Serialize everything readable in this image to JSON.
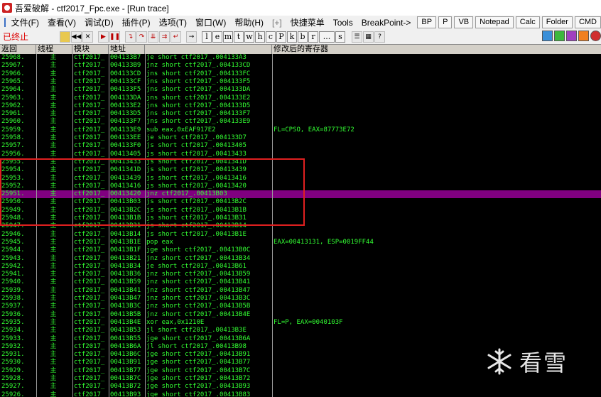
{
  "window": {
    "title": "吾爱破解 - ctf2017_Fpc.exe - [Run trace]"
  },
  "menu": {
    "items": [
      "文件(F)",
      "查看(V)",
      "调试(D)",
      "插件(P)",
      "选项(T)",
      "窗口(W)",
      "帮助(H)",
      "[+]",
      "快捷菜单",
      "Tools",
      "BreakPoint->"
    ],
    "buttons": [
      "BP",
      "P",
      "VB",
      "Notepad",
      "Calc",
      "Folder",
      "CMD"
    ]
  },
  "toolbar": {
    "status": "已终止",
    "letters": [
      "l",
      "e",
      "m",
      "t",
      "w",
      "h",
      "c",
      "P",
      "k",
      "b",
      "r",
      "...",
      "s"
    ]
  },
  "table": {
    "headers": [
      "返回",
      "线程",
      "模块",
      "地址",
      "",
      "修改后的寄存器"
    ],
    "thread_marker": "主",
    "rows": [
      [
        "25968.",
        "ctf2017_",
        "004133B7",
        "je short ctf2017_.004133A3",
        ""
      ],
      [
        "25967.",
        "ctf2017_",
        "004133B9",
        "jnz short ctf2017_.004133CD",
        ""
      ],
      [
        "25966.",
        "ctf2017_",
        "004133CD",
        "jns short ctf2017_.004133FC",
        ""
      ],
      [
        "25965.",
        "ctf2017_",
        "004133CF",
        "jns short ctf2017_.004133F5",
        ""
      ],
      [
        "25964.",
        "ctf2017_",
        "004133F5",
        "jns short ctf2017_.004133DA",
        ""
      ],
      [
        "25963.",
        "ctf2017_",
        "004133DA",
        "jns short ctf2017_.004133E2",
        ""
      ],
      [
        "25962.",
        "ctf2017_",
        "004133E2",
        "jns short ctf2017_.004133D5",
        ""
      ],
      [
        "25961.",
        "ctf2017_",
        "004133D5",
        "jns short ctf2017_.004133F7",
        ""
      ],
      [
        "25960.",
        "ctf2017_",
        "004133F7",
        "jns short ctf2017_.004133E9",
        ""
      ],
      [
        "25959.",
        "ctf2017_",
        "004133E9",
        "sub eax,0xEAF917E2",
        "FL=CPSO, EAX=87773E72"
      ],
      [
        "25958.",
        "ctf2017_",
        "004133EE",
        "je short ctf2017_.004133D7",
        ""
      ],
      [
        "25957.",
        "ctf2017_",
        "004133F0",
        "js short ctf2017_.00413405",
        ""
      ],
      [
        "25956.",
        "ctf2017_",
        "00413405",
        "js short ctf2017_.00413433",
        ""
      ],
      [
        "25955.",
        "ctf2017_",
        "00413433",
        "js short ctf2017_.0041341D",
        ""
      ],
      [
        "25954.",
        "ctf2017_",
        "0041341D",
        "js short ctf2017_.00413439",
        ""
      ],
      [
        "25953.",
        "ctf2017_",
        "00413439",
        "js short ctf2017_.00413416",
        ""
      ],
      [
        "25952.",
        "ctf2017_",
        "00413416",
        "js short ctf2017_.00413420",
        ""
      ],
      [
        "25951.",
        "ctf2017_",
        "00413420",
        "jnz ctf2017_.00413B03",
        ""
      ],
      [
        "25950.",
        "ctf2017_",
        "00413B03",
        "js short ctf2017_.00413B2C",
        ""
      ],
      [
        "25949.",
        "ctf2017_",
        "00413B2C",
        "js short ctf2017_.00413B1B",
        ""
      ],
      [
        "25948.",
        "ctf2017_",
        "00413B1B",
        "js short ctf2017_.00413B31",
        ""
      ],
      [
        "25947.",
        "ctf2017_",
        "00413B31",
        "js short ctf2017_.00413B14",
        ""
      ],
      [
        "25946.",
        "ctf2017_",
        "00413B14",
        "js short ctf2017_.00413B1E",
        ""
      ],
      [
        "25945.",
        "ctf2017_",
        "00413B1E",
        "pop eax",
        "EAX=00413131, ESP=0019FF44"
      ],
      [
        "25944.",
        "ctf2017_",
        "00413B1F",
        "jge short ctf2017_.00413B0C",
        ""
      ],
      [
        "25943.",
        "ctf2017_",
        "00413B21",
        "jnz short ctf2017_.00413B34",
        ""
      ],
      [
        "25942.",
        "ctf2017_",
        "00413B34",
        "je short ctf2017_.00413B61",
        ""
      ],
      [
        "25941.",
        "ctf2017_",
        "00413B36",
        "jnz short ctf2017_.00413B59",
        ""
      ],
      [
        "25940.",
        "ctf2017_",
        "00413B59",
        "jnz short ctf2017_.00413B41",
        ""
      ],
      [
        "25939.",
        "ctf2017_",
        "00413B41",
        "jnz short ctf2017_.00413B47",
        ""
      ],
      [
        "25938.",
        "ctf2017_",
        "00413B47",
        "jnz short ctf2017_.00413B3C",
        ""
      ],
      [
        "25937.",
        "ctf2017_",
        "00413B3C",
        "jnz short ctf2017_.00413B5B",
        ""
      ],
      [
        "25936.",
        "ctf2017_",
        "00413B5B",
        "jnz short ctf2017_.00413B4E",
        ""
      ],
      [
        "25935.",
        "ctf2017_",
        "00413B4E",
        "xor eax,0x1210E",
        "FL=P, EAX=0040103F"
      ],
      [
        "25934.",
        "ctf2017_",
        "00413B53",
        "jl short ctf2017_.00413B3E",
        ""
      ],
      [
        "25933.",
        "ctf2017_",
        "00413B55",
        "jge short ctf2017_.00413B6A",
        ""
      ],
      [
        "25932.",
        "ctf2017_",
        "00413B6A",
        "jl short ctf2017_.00413B98",
        ""
      ],
      [
        "25931.",
        "ctf2017_",
        "00413B6C",
        "jge short ctf2017_.00413B91",
        ""
      ],
      [
        "25930.",
        "ctf2017_",
        "00413B91",
        "jge short ctf2017_.00413B77",
        ""
      ],
      [
        "25929.",
        "ctf2017_",
        "00413B77",
        "jge short ctf2017_.00413B7C",
        ""
      ],
      [
        "25928.",
        "ctf2017_",
        "00413B7C",
        "jge short ctf2017_.00413B72",
        ""
      ],
      [
        "25927.",
        "ctf2017_",
        "00413B72",
        "jge short ctf2017_.00413B93",
        ""
      ],
      [
        "25926.",
        "ctf2017_",
        "00413B93",
        "jge short ctf2017_.00413B83",
        ""
      ]
    ],
    "selected_index": 17
  },
  "watermark": {
    "text": "看雪"
  },
  "colors": {
    "trace_text": "#33ff33",
    "selected_row": "#800080",
    "highlight_box": "#e02020",
    "status_text": "#dd0000"
  }
}
